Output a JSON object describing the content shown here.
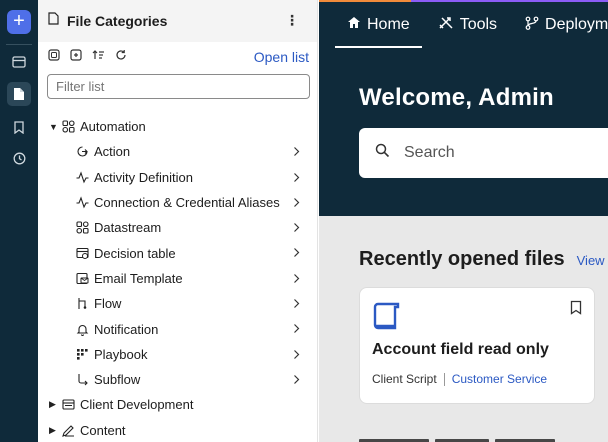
{
  "rail": {
    "add_label": "+",
    "items": [
      "records-icon",
      "document-icon",
      "bookmark-icon",
      "history-icon"
    ]
  },
  "panel": {
    "title": "File Categories",
    "menu_glyph": "⋮",
    "open_list": "Open list",
    "filter_placeholder": "Filter list"
  },
  "tree": {
    "automation": {
      "label": "Automation",
      "children": [
        {
          "label": "Action",
          "icon": "action-icon"
        },
        {
          "label": "Activity Definition",
          "icon": "activity-icon"
        },
        {
          "label": "Connection & Credential Aliases",
          "icon": "connection-icon"
        },
        {
          "label": "Datastream",
          "icon": "datastream-icon"
        },
        {
          "label": "Decision table",
          "icon": "decision-table-icon"
        },
        {
          "label": "Email Template",
          "icon": "email-template-icon"
        },
        {
          "label": "Flow",
          "icon": "flow-icon"
        },
        {
          "label": "Notification",
          "icon": "bell-icon"
        },
        {
          "label": "Playbook",
          "icon": "playbook-icon"
        },
        {
          "label": "Subflow",
          "icon": "subflow-icon"
        }
      ]
    },
    "client_development": {
      "label": "Client Development"
    },
    "content": {
      "label": "Content"
    }
  },
  "nav": {
    "home": "Home",
    "tools": "Tools",
    "deployment": "Deploym"
  },
  "hero": {
    "welcome": "Welcome, Admin",
    "search_placeholder": "Search"
  },
  "recent": {
    "heading": "Recently opened files",
    "view_link": "View",
    "card": {
      "title": "Account field read only",
      "type": "Client Script",
      "app": "Customer Service"
    }
  },
  "colors": {
    "dark_navy": "#0f2a3a",
    "accent_blue": "#4f6fe8",
    "link_blue": "#2b59c3",
    "strip_orange": "#f08a3a",
    "strip_purple": "#8b5cf6"
  }
}
